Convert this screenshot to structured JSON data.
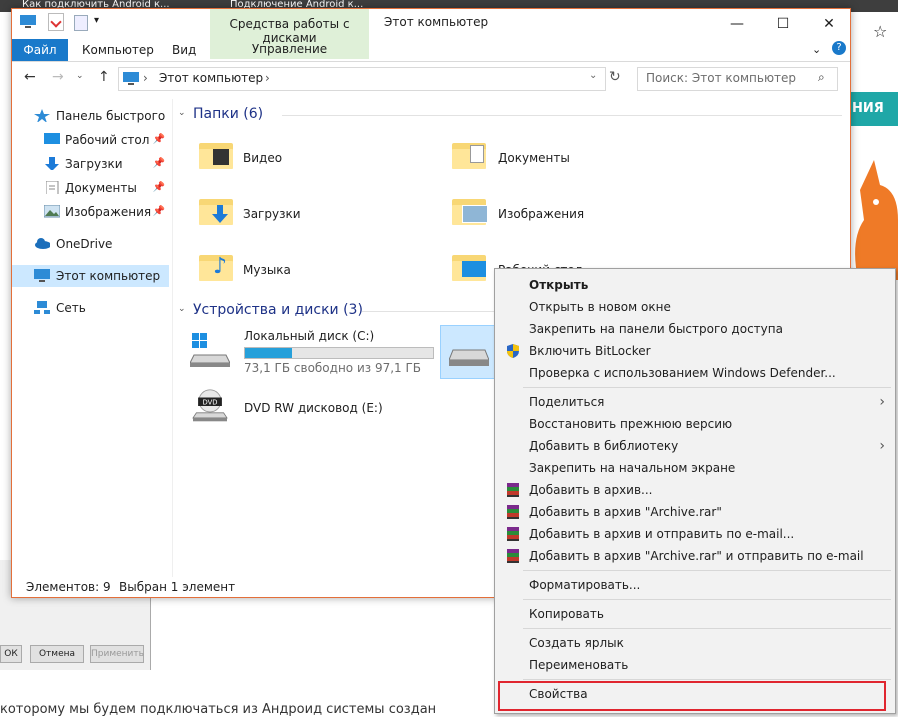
{
  "browser": {
    "tabs": [
      "Как подключить Android к...",
      "Подключение Android к..."
    ],
    "bottom_text": "которому мы будем подключаться из Андроид системы создан",
    "banner": "НИЯ",
    "dialog_buttons": [
      "ОК",
      "Отмена",
      "Применить"
    ]
  },
  "window": {
    "title": "Этот компьютер",
    "context_group": "Средства работы с дисками",
    "tabs": {
      "file": "Файл",
      "computer": "Компьютер",
      "view": "Вид",
      "manage": "Управление"
    },
    "help": "?",
    "controls": {
      "minimize": "—",
      "maximize": "☐",
      "close": "✕"
    }
  },
  "address": {
    "path": "Этот компьютер",
    "search_placeholder": "Поиск: Этот компьютер"
  },
  "nav": {
    "quick_access": "Панель быстрого доступа",
    "desktop": "Рабочий стол",
    "downloads": "Загрузки",
    "documents": "Документы",
    "pictures": "Изображения",
    "onedrive": "OneDrive",
    "this_pc": "Этот компьютер",
    "network": "Сеть"
  },
  "folders": {
    "header": "Папки (6)",
    "items": [
      "Видео",
      "Документы",
      "Загрузки",
      "Изображения",
      "Музыка",
      "Рабочий стол"
    ]
  },
  "devices": {
    "header": "Устройства и диски (3)",
    "local_disk": {
      "name": "Локальный диск (C:)",
      "free": "73,1 ГБ свободно из 97,1 ГБ",
      "used_fraction": 0.25
    },
    "dvd": {
      "name": "DVD RW дисковод (E:)",
      "badge": "DVD"
    }
  },
  "status": {
    "count": "Элементов: 9",
    "selected": "Выбран 1 элемент"
  },
  "menu": {
    "open": "Открыть",
    "open_new_window": "Открыть в новом окне",
    "pin_quick": "Закрепить на панели быстрого доступа",
    "bitlocker": "Включить BitLocker",
    "defender": "Проверка с использованием Windows Defender...",
    "share": "Поделиться",
    "restore": "Восстановить прежнюю версию",
    "add_library": "Добавить в библиотеку",
    "pin_start": "Закрепить на начальном экране",
    "add_archive": "Добавить в архив...",
    "add_archive_rar": "Добавить в архив \"Archive.rar\"",
    "add_archive_email": "Добавить в архив и отправить по e-mail...",
    "add_archive_rar_email": "Добавить в архив \"Archive.rar\" и отправить по e-mail",
    "format": "Форматировать...",
    "copy": "Копировать",
    "shortcut": "Создать ярлык",
    "rename": "Переименовать",
    "properties": "Свойства"
  },
  "colors": {
    "accent": "#1979ca",
    "context_tab": "#dff0d8",
    "highlight": "#e0262f",
    "selection": "#cce8ff"
  }
}
